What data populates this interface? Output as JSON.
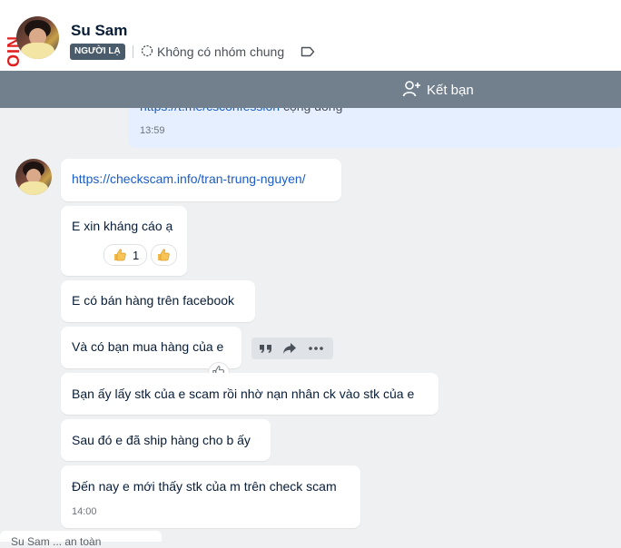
{
  "header": {
    "contact_name": "Su Sam",
    "stranger_badge": "NGƯỜI LẠ",
    "groups_text": "Không có nhóm chung",
    "edge_logo_text": "OIN"
  },
  "add_friend": {
    "label": "Kết bạn"
  },
  "sent_message": {
    "link_text": "https://t.me/csconfession",
    "trailing_text": " cộng đồng",
    "time": "13:59"
  },
  "messages": [
    {
      "text": "https://checkscam.info/tran-trung-nguyen/",
      "is_link": true
    },
    {
      "text": "E xin kháng cáo ạ",
      "reaction_count": "1"
    },
    {
      "text": "E có bán hàng trên facebook"
    },
    {
      "text": "Và có bạn mua hàng của e"
    },
    {
      "text": "Bạn ấy lấy stk của e scam rồi nhờ nạn nhân ck vào stk của e"
    },
    {
      "text": "Sau đó e đã ship hàng cho b ấy"
    },
    {
      "text": "Đến nay e mới thấy stk của m trên check scam",
      "time": "14:00"
    }
  ],
  "bottom_preview": {
    "text": "Su Sam ... an toàn"
  },
  "colors": {
    "accent_link": "#1a5dc7",
    "add_friend_bar": "#72808d",
    "sent_bubble": "#e5efff",
    "badge": "#4a5b6b"
  },
  "icons": {
    "group": "dashed-circle-icon",
    "tag": "tag-icon",
    "add_friend": "person-plus-icon",
    "reaction": "thumbs-up-icon",
    "quote": "quote-icon",
    "forward": "forward-icon",
    "more": "more-dots-icon"
  }
}
